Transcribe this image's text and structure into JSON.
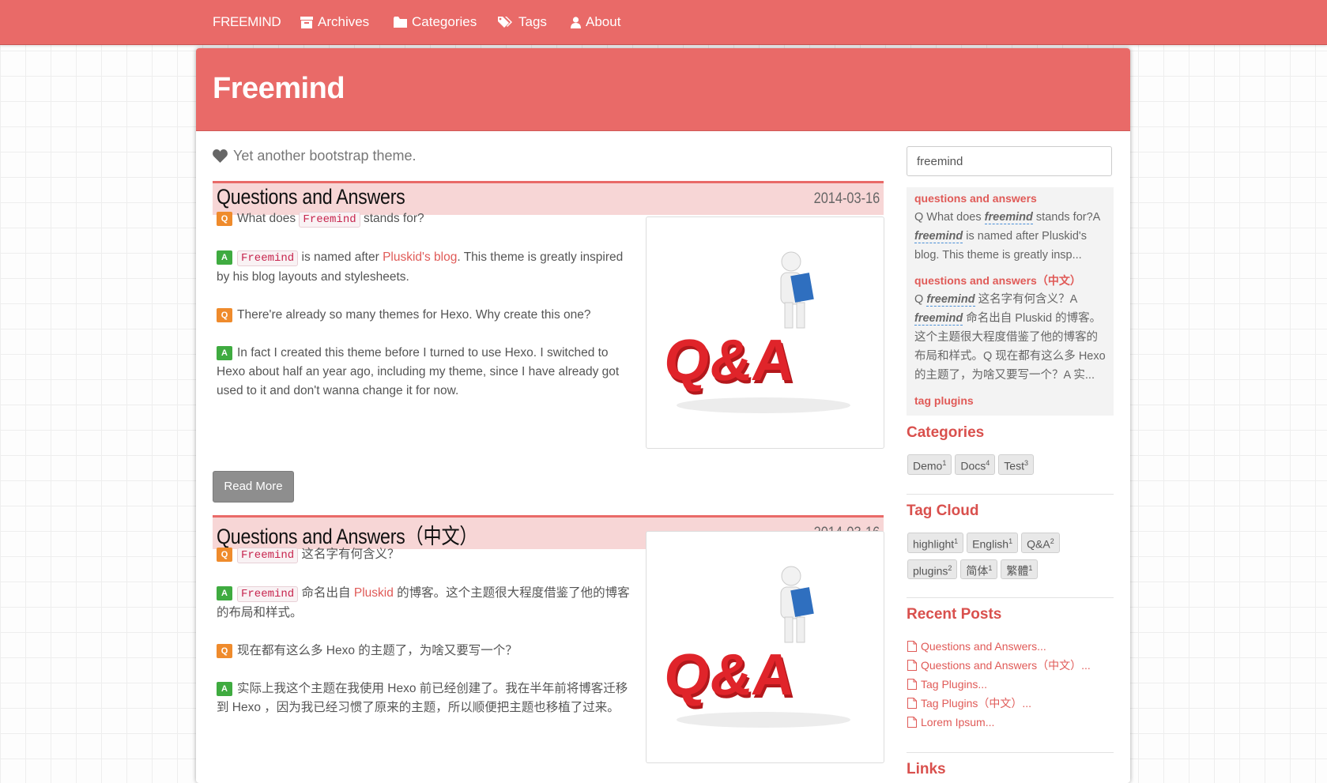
{
  "nav": {
    "brand": "FREEMIND",
    "items": [
      {
        "label": "Archives",
        "icon": "archive-icon"
      },
      {
        "label": "Categories",
        "icon": "folder-icon"
      },
      {
        "label": "Tags",
        "icon": "tags-icon"
      },
      {
        "label": "About",
        "icon": "user-icon"
      }
    ]
  },
  "header": {
    "title": "Freemind",
    "tagline": "Yet another bootstrap theme."
  },
  "posts": [
    {
      "title": "Questions and Answers",
      "date": "2014-03-16",
      "q1_text": "What does",
      "q1_code": "Freemind",
      "q1_tail": "stands for?",
      "a1_code": "Freemind",
      "a1_pre": "is named after",
      "a1_link": "Pluskid's blog",
      "a1_tail": ". This theme is greatly inspired by his blog layouts and stylesheets.",
      "q2": "There're already so many themes for Hexo. Why create this one?",
      "a2": "In fact I created this theme before I turned to use Hexo. I switched to Hexo about half an year ago, including my theme, since I have already got used to it and don't wanna change it for now."
    },
    {
      "title": "Questions and Answers（中文）",
      "date": "2014-03-16",
      "q1_code": "Freemind",
      "q1_tail": "这名字有何含义？",
      "a1_code": "Freemind",
      "a1_pre": "命名出自",
      "a1_link": "Pluskid",
      "a1_tail": "的博客。这个主题很大程度借鉴了他的博客的布局和样式。",
      "q2": "现在都有这么多 Hexo 的主题了，为啥又要写一个？",
      "a2": "实际上我这个主题在我使用 Hexo 前已经创建了。我在半年前将博客迁移到 Hexo ，因为我已经习惯了原来的主题，所以顺便把主题也移植了过来。"
    }
  ],
  "badges": {
    "q": "Q",
    "a": "A"
  },
  "read_more": "Read More",
  "image_alt": "Q&A",
  "sidebar": {
    "search_value": "freemind",
    "results": [
      {
        "title": "questions and answers",
        "pre": "Q What does ",
        "em": "freemind",
        "mid": " stands for?A ",
        "em2": "freemind",
        "tail": " is named after Pluskid's blog. This theme is greatly insp..."
      },
      {
        "title": "questions and answers（中文）",
        "pre": "Q ",
        "em": "freemind",
        "mid": " 这名字有何含义？A ",
        "em2": "freemind",
        "tail": " 命名出自 Pluskid 的博客。这个主题很大程度借鉴了他的博客的布局和样式。Q 现在都有这么多 Hexo 的主题了，为啥又要写一个？A 实..."
      },
      {
        "title": "tag plugins"
      }
    ],
    "categories_heading": "Categories",
    "categories": [
      {
        "name": "Demo",
        "count": "1"
      },
      {
        "name": "Docs",
        "count": "4"
      },
      {
        "name": "Test",
        "count": "3"
      }
    ],
    "tagcloud_heading": "Tag Cloud",
    "tags_row1": [
      {
        "name": "highlight",
        "count": "1"
      },
      {
        "name": "English",
        "count": "1"
      },
      {
        "name": "Q&A",
        "count": "2"
      }
    ],
    "tags_row2": [
      {
        "name": "plugins",
        "count": "2"
      },
      {
        "name": "简体",
        "count": "1"
      },
      {
        "name": "繁體",
        "count": "1"
      }
    ],
    "recent_heading": "Recent Posts",
    "recent": [
      "Questions and Answers...",
      "Questions and Answers（中文）...",
      "Tag Plugins...",
      "Tag Plugins（中文）...",
      "Lorem Ipsum..."
    ],
    "links_heading": "Links"
  },
  "colors": {
    "accent": "#e96a68",
    "title_bg": "#f7d6d6",
    "link": "#e05a57"
  }
}
